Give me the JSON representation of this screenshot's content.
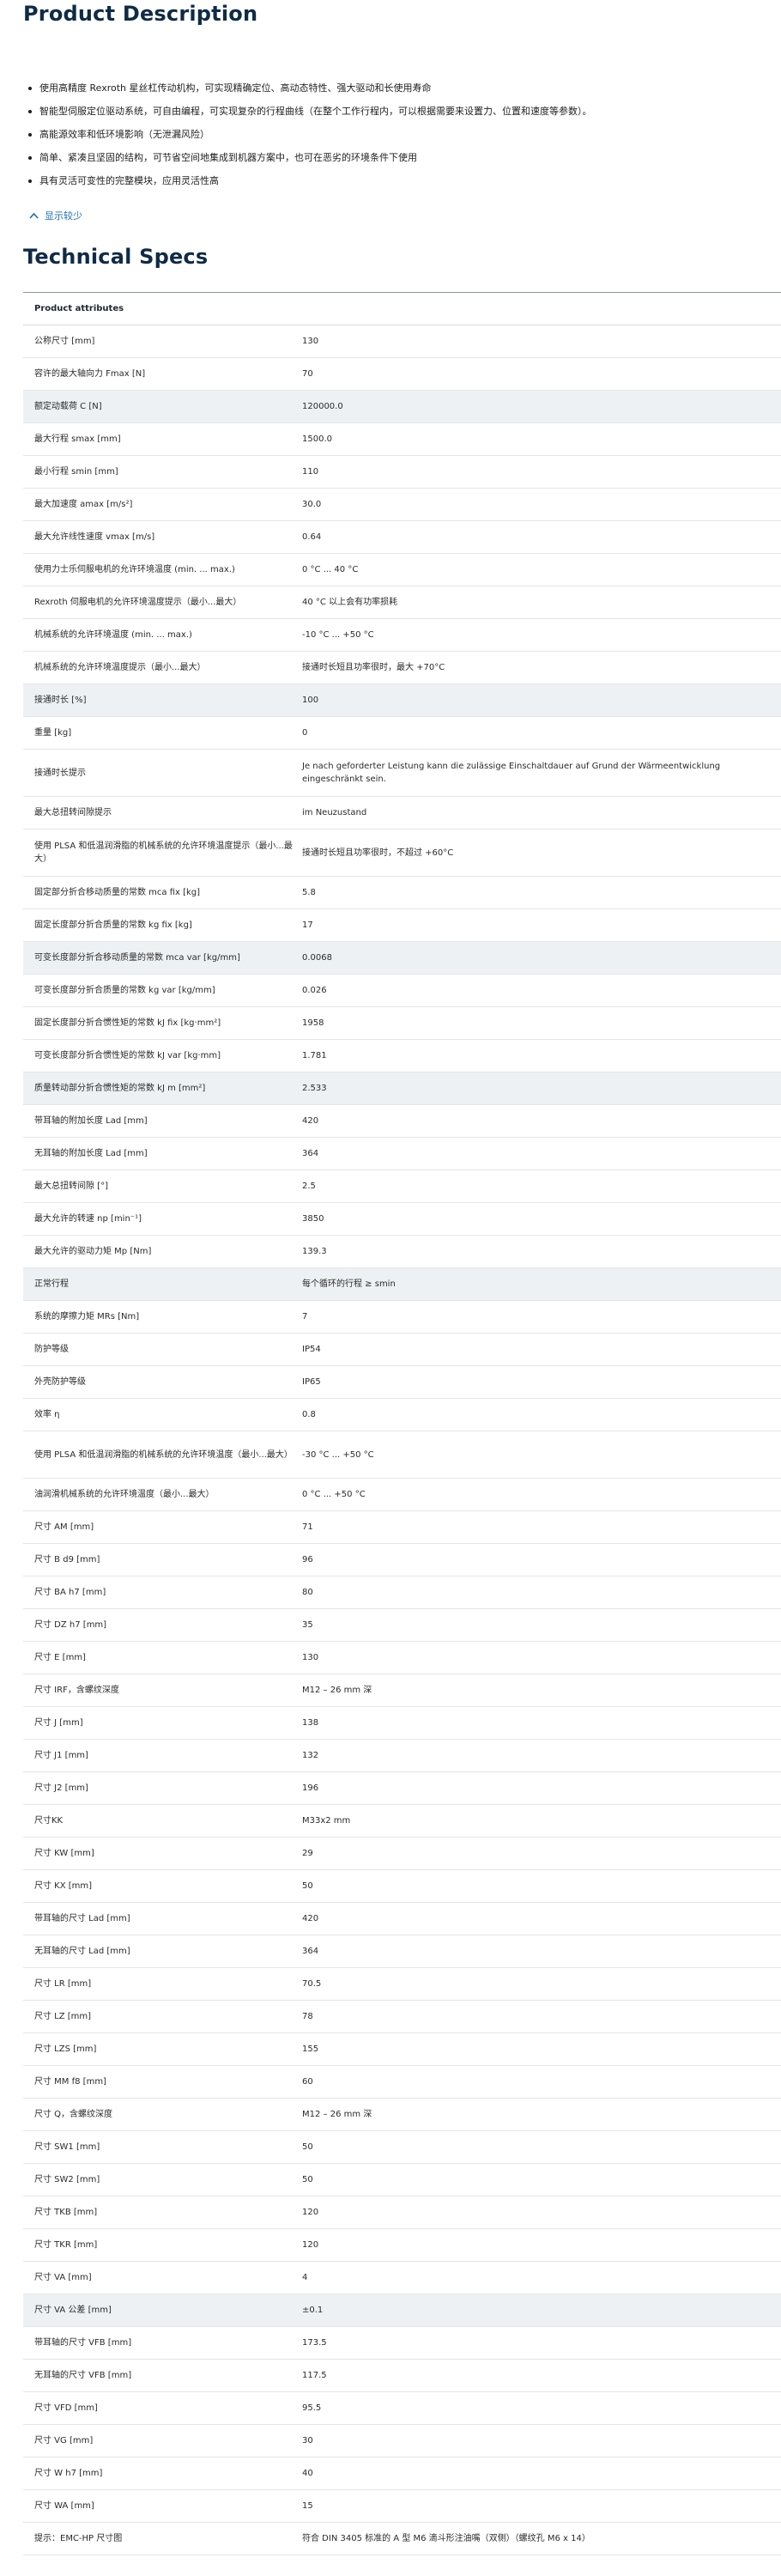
{
  "product_description": {
    "title": "Product Description",
    "bullets": [
      "使用高精度 Rexroth 星丝杠传动机构，可实现精确定位、高动态特性、强大驱动和长使用寿命",
      "智能型伺服定位驱动系统，可自由编程，可实现复杂的行程曲线（在整个工作行程内，可以根据需要来设置力、位置和速度等参数）。",
      "高能源效率和低环境影响（无泄漏风险）",
      "简单、紧凑且坚固的结构，可节省空间地集成到机器方案中，也可在恶劣的环境条件下使用",
      "具有灵活可变性的完整模块，应用灵活性高"
    ],
    "toggle_label": "显示较少",
    "toggle_icon": "chevron-up-icon"
  },
  "technical_specs": {
    "title": "Technical Specs",
    "table_header": "Product attributes",
    "rows": [
      {
        "label": "公称尺寸 [mm]",
        "value": "130"
      },
      {
        "label": "容许的最大轴向力 Fmax [N]",
        "value": "70"
      },
      {
        "label": "额定动载荷 C [N]",
        "value": "120000.0"
      },
      {
        "label": "最大行程 smax [mm]",
        "value": "1500.0"
      },
      {
        "label": "最小行程 smin [mm]",
        "value": "110"
      },
      {
        "label": "最大加速度 amax [m/s²]",
        "value": "30.0"
      },
      {
        "label": "最大允许线性速度 vmax [m/s]",
        "value": "0.64"
      },
      {
        "label": "使用力士乐伺服电机的允许环境温度 (min. ... max.)",
        "value": "0 °C ... 40 °C"
      },
      {
        "label": "Rexroth 伺服电机的允许环境温度提示（最小...最大）",
        "value": "40 °C 以上会有功率损耗"
      },
      {
        "label": "机械系统的允许环境温度 (min. ... max.)",
        "value": "-10 °C ... +50 °C"
      },
      {
        "label": "机械系统的允许环境温度提示（最小...最大）",
        "value": "接通时长短且功率很时，最大 +70°C"
      },
      {
        "label": "接通时长 [%]",
        "value": "100"
      },
      {
        "label": "重量 [kg]",
        "value": "0"
      },
      {
        "label": "接通时长提示",
        "value": "Je nach geforderter Leistung kann die zulässige Einschaltdauer auf Grund der Wärmeentwicklung eingeschränkt sein."
      },
      {
        "label": "最大总扭转间隙提示",
        "value": "im Neuzustand"
      },
      {
        "label": "使用 PLSA 和低温润滑脂的机械系统的允许环境温度提示（最小...最大）",
        "value": "接通时长短且功率很时，不超过 +60°C"
      },
      {
        "label": "固定部分折合移动质量的常数 mca fix [kg]",
        "value": "5.8"
      },
      {
        "label": "固定长度部分折合质量的常数 kg fix [kg]",
        "value": "17"
      },
      {
        "label": "可变长度部分折合移动质量的常数 mca var [kg/mm]",
        "value": "0.0068"
      },
      {
        "label": "可变长度部分折合质量的常数 kg var [kg/mm]",
        "value": "0.026"
      },
      {
        "label": "固定长度部分折合惯性矩的常数 kJ fix [kg·mm²]",
        "value": "1958"
      },
      {
        "label": "可变长度部分折合惯性矩的常数 kJ var [kg·mm]",
        "value": "1.781"
      },
      {
        "label": "质量转动部分折合惯性矩的常数 kJ m [mm²]",
        "value": "2.533"
      },
      {
        "label": "带耳轴的附加长度 Lad [mm]",
        "value": "420"
      },
      {
        "label": "无耳轴的附加长度 Lad [mm]",
        "value": "364"
      },
      {
        "label": "最大总扭转间隙 [°]",
        "value": "2.5"
      },
      {
        "label": "最大允许的转速 np [min⁻¹]",
        "value": "3850"
      },
      {
        "label": "最大允许的驱动力矩 Mp [Nm]",
        "value": "139.3"
      },
      {
        "label": "正常行程",
        "value": "每个循环的行程 ≥ smin"
      },
      {
        "label": "系统的摩擦力矩 MRs [Nm]",
        "value": "7"
      },
      {
        "label": "防护等级",
        "value": "IP54"
      },
      {
        "label": "外壳防护等级",
        "value": "IP65"
      },
      {
        "label": "效率 η",
        "value": "0.8"
      },
      {
        "label": "使用 PLSA 和低温润滑脂的机械系统的允许环境温度（最小...最大）",
        "value": "-30 °C ... +50 °C"
      },
      {
        "label": "油润滑机械系统的允许环境温度（最小...最大）",
        "value": "0 °C ... +50 °C"
      },
      {
        "label": "尺寸 AM [mm]",
        "value": "71"
      },
      {
        "label": "尺寸 B d9 [mm]",
        "value": "96"
      },
      {
        "label": "尺寸 BA h7 [mm]",
        "value": "80"
      },
      {
        "label": "尺寸 DZ h7 [mm]",
        "value": "35"
      },
      {
        "label": "尺寸 E [mm]",
        "value": "130"
      },
      {
        "label": "尺寸 IRF，含螺纹深度",
        "value": "M12 – 26 mm 深"
      },
      {
        "label": "尺寸 J [mm]",
        "value": "138"
      },
      {
        "label": "尺寸 J1 [mm]",
        "value": "132"
      },
      {
        "label": "尺寸 J2 [mm]",
        "value": "196"
      },
      {
        "label": "尺寸KK",
        "value": "M33x2 mm"
      },
      {
        "label": "尺寸 KW [mm]",
        "value": "29"
      },
      {
        "label": "尺寸 KX [mm]",
        "value": "50"
      },
      {
        "label": "带耳轴的尺寸 Lad [mm]",
        "value": "420"
      },
      {
        "label": "无耳轴的尺寸 Lad [mm]",
        "value": "364"
      },
      {
        "label": "尺寸 LR [mm]",
        "value": "70.5"
      },
      {
        "label": "尺寸 LZ [mm]",
        "value": "78"
      },
      {
        "label": "尺寸 LZS [mm]",
        "value": "155"
      },
      {
        "label": "尺寸 MM f8 [mm]",
        "value": "60"
      },
      {
        "label": "尺寸 Q，含螺纹深度",
        "value": "M12 – 26 mm 深"
      },
      {
        "label": "尺寸 SW1 [mm]",
        "value": "50"
      },
      {
        "label": "尺寸 SW2 [mm]",
        "value": "50"
      },
      {
        "label": "尺寸 TKB [mm]",
        "value": "120"
      },
      {
        "label": "尺寸 TKR [mm]",
        "value": "120"
      },
      {
        "label": "尺寸 VA [mm]",
        "value": "4"
      },
      {
        "label": "尺寸 VA 公差 [mm]",
        "value": "±0.1"
      },
      {
        "label": "带耳轴的尺寸 VFB [mm]",
        "value": "173.5"
      },
      {
        "label": "无耳轴的尺寸 VFB [mm]",
        "value": "117.5"
      },
      {
        "label": "尺寸 VFD [mm]",
        "value": "95.5"
      },
      {
        "label": "尺寸 VG [mm]",
        "value": "30"
      },
      {
        "label": "尺寸 W h7 [mm]",
        "value": "40"
      },
      {
        "label": "尺寸 WA [mm]",
        "value": "15"
      },
      {
        "label": "提示：EMC-HP 尺寸图",
        "value": "符合 DIN 3405 标准的 A 型 M6 滴斗形注油嘴（双侧）（螺纹孔 M6 x 14）"
      }
    ]
  }
}
